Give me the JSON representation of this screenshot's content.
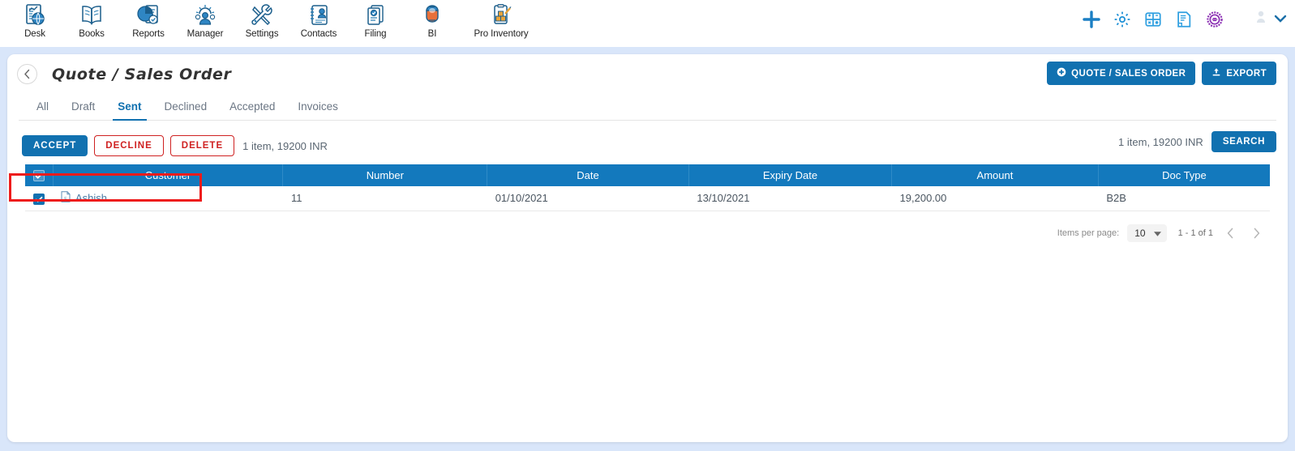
{
  "appbar": {
    "tiles": [
      {
        "label": "Desk",
        "icon": "desk-icon"
      },
      {
        "label": "Books",
        "icon": "books-icon"
      },
      {
        "label": "Reports",
        "icon": "reports-icon"
      },
      {
        "label": "Manager",
        "icon": "manager-icon"
      },
      {
        "label": "Settings",
        "icon": "settings-icon"
      },
      {
        "label": "Contacts",
        "icon": "contacts-icon"
      },
      {
        "label": "Filing",
        "icon": "filing-icon"
      },
      {
        "label": "BI",
        "icon": "bi-icon"
      },
      {
        "label": "Pro Inventory",
        "icon": "pro-inventory-icon"
      }
    ],
    "right_icons": [
      {
        "name": "add-icon",
        "color": "#1b7fc4"
      },
      {
        "name": "gear-icon",
        "color": "#1b8fd6"
      },
      {
        "name": "calculator-icon",
        "color": "#2f9fe0"
      },
      {
        "name": "notes-icon",
        "color": "#2f9fe0"
      },
      {
        "name": "seal-icon",
        "color": "#8b2fb3"
      }
    ],
    "user_chevron": "chevron-down-icon"
  },
  "header": {
    "back_label": "‹",
    "title": "Quote / Sales Order",
    "actions": [
      {
        "label": "QUOTE / SALES ORDER",
        "icon": "plus-circle-icon"
      },
      {
        "label": "EXPORT",
        "icon": "upload-icon"
      }
    ]
  },
  "tabs": [
    {
      "label": "All",
      "active": false
    },
    {
      "label": "Draft",
      "active": false
    },
    {
      "label": "Sent",
      "active": true
    },
    {
      "label": "Declined",
      "active": false
    },
    {
      "label": "Accepted",
      "active": false
    },
    {
      "label": "Invoices",
      "active": false
    }
  ],
  "action_bar": {
    "accept_label": "ACCEPT",
    "decline_label": "DECLINE",
    "delete_label": "DELETE",
    "summary_left": "1 item, 19200 INR",
    "summary_right": "1 item, 19200 INR",
    "search_label": "SEARCH",
    "highlight_color": "#ee1c1c"
  },
  "table": {
    "columns": [
      "Customer",
      "Number",
      "Date",
      "Expiry Date",
      "Amount",
      "Doc Type"
    ],
    "header_checkbox_checked": true,
    "rows": [
      {
        "selected": true,
        "customer": "Ashish",
        "customer_icon": "file-icon",
        "number": "11",
        "date": "01/10/2021",
        "expiry_date": "13/10/2021",
        "amount": "19,200.00",
        "doc_type": "B2B"
      }
    ]
  },
  "paginator": {
    "items_per_page_label": "Items per page:",
    "items_per_page_value": "10",
    "range_label": "1 - 1 of 1",
    "prev_icon": "chevron-left-icon",
    "next_icon": "chevron-right-icon"
  },
  "theme": {
    "accent": "#1171b0",
    "table_header": "#1379bd",
    "page_bg": "#d9e6fa",
    "danger": "#cf2121"
  }
}
